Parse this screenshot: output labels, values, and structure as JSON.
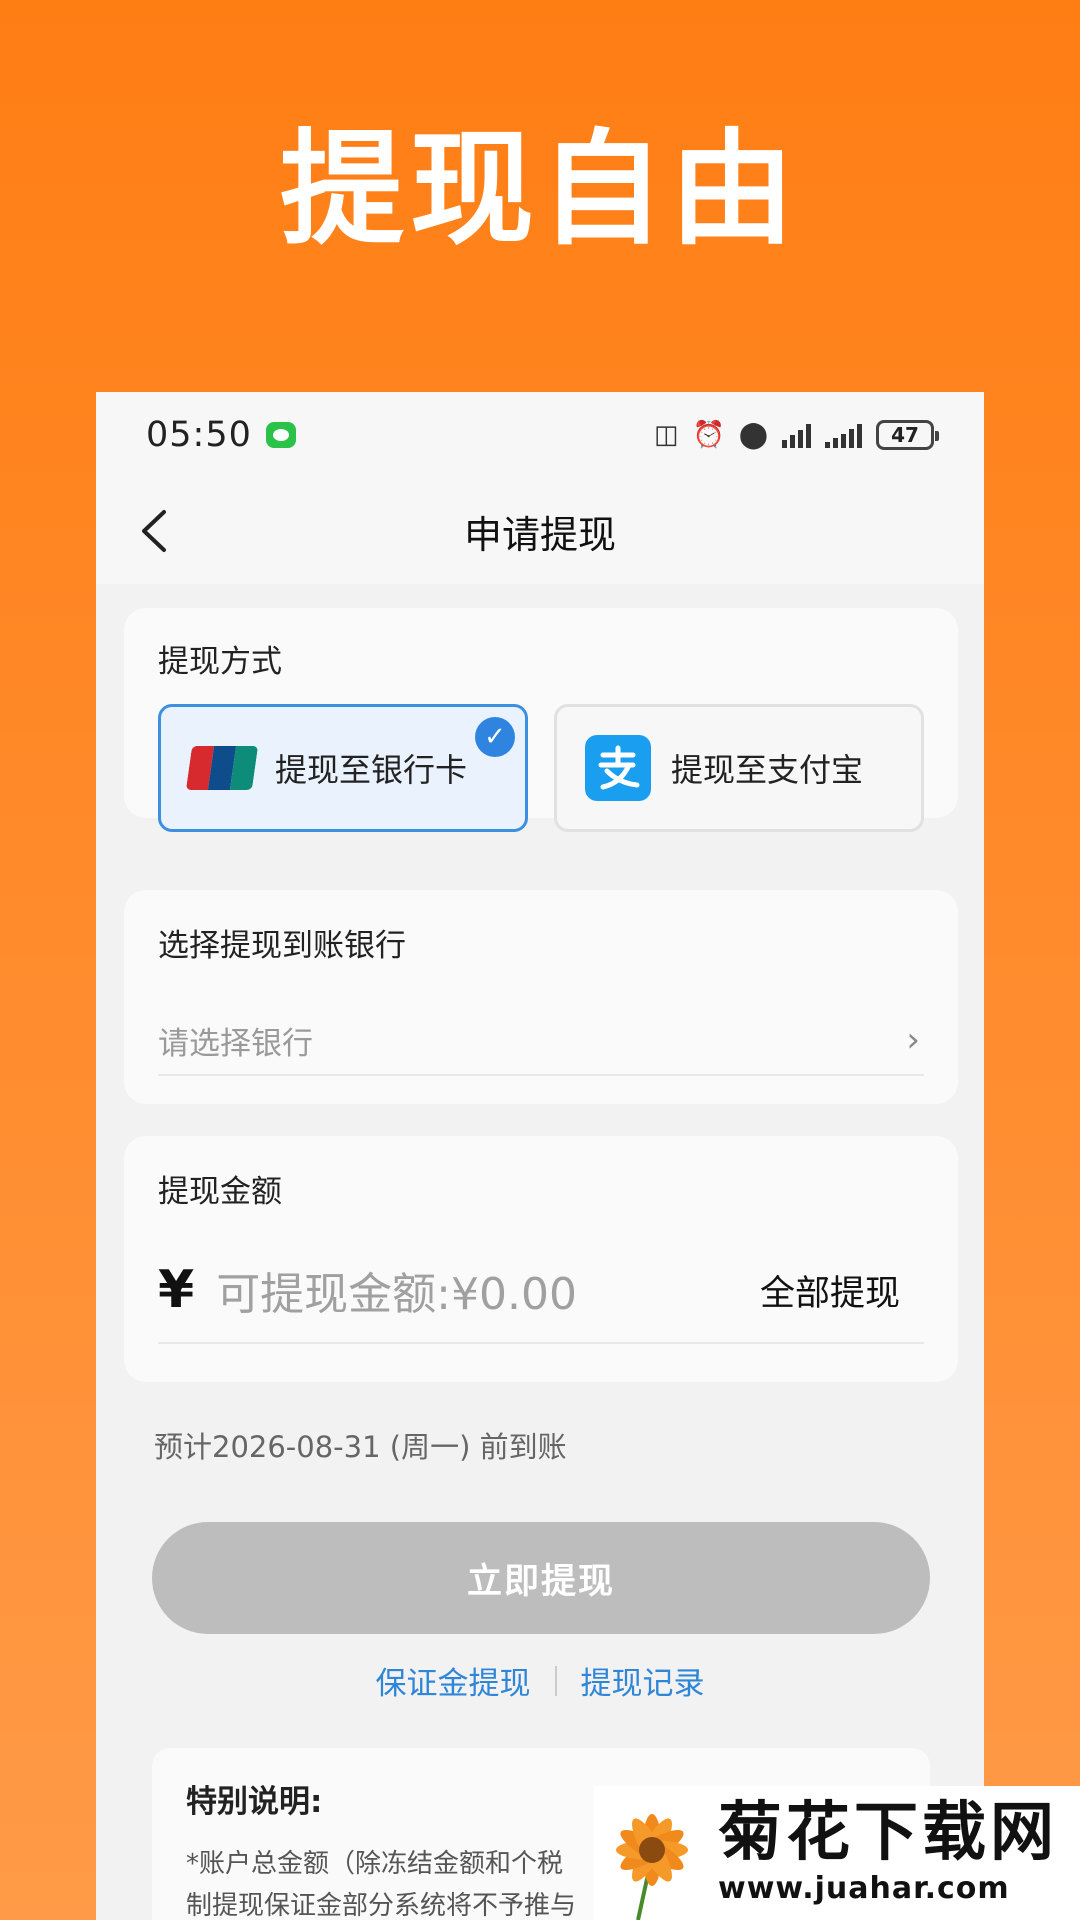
{
  "headline": "提现自由",
  "status_bar": {
    "time": "05:50",
    "battery": "47"
  },
  "nav": {
    "title": "申请提现"
  },
  "withdraw_method": {
    "label": "提现方式",
    "options": [
      {
        "label": "提现至银行卡",
        "selected": true,
        "icon": "unionpay-icon"
      },
      {
        "label": "提现至支付宝",
        "selected": false,
        "icon": "alipay-icon"
      }
    ],
    "check_glyph": "✓"
  },
  "bank_select": {
    "label": "选择提现到账银行",
    "placeholder": "请选择银行",
    "chevron": "›"
  },
  "amount": {
    "label": "提现金额",
    "currency": "¥",
    "placeholder": "可提现金额:¥0.00",
    "withdraw_all": "全部提现"
  },
  "eta_text": "预计2026-08-31 (周一) 前到账",
  "submit_label": "立即提现",
  "links": {
    "deposit": "保证金提现",
    "records": "提现记录"
  },
  "note": {
    "title": "特别说明:",
    "line1": "*账户总金额（除冻结金额和个税",
    "line2": "制提现保证金部分系统将不予推与"
  },
  "watermark": {
    "cn": "菊花下载网",
    "url": "www.juahar.com"
  },
  "colors": {
    "background_orange": "#FF7E14",
    "link_blue": "#2F86D8",
    "selected_border": "#3D8FE0",
    "button_disabled": "#BDBDBD"
  }
}
